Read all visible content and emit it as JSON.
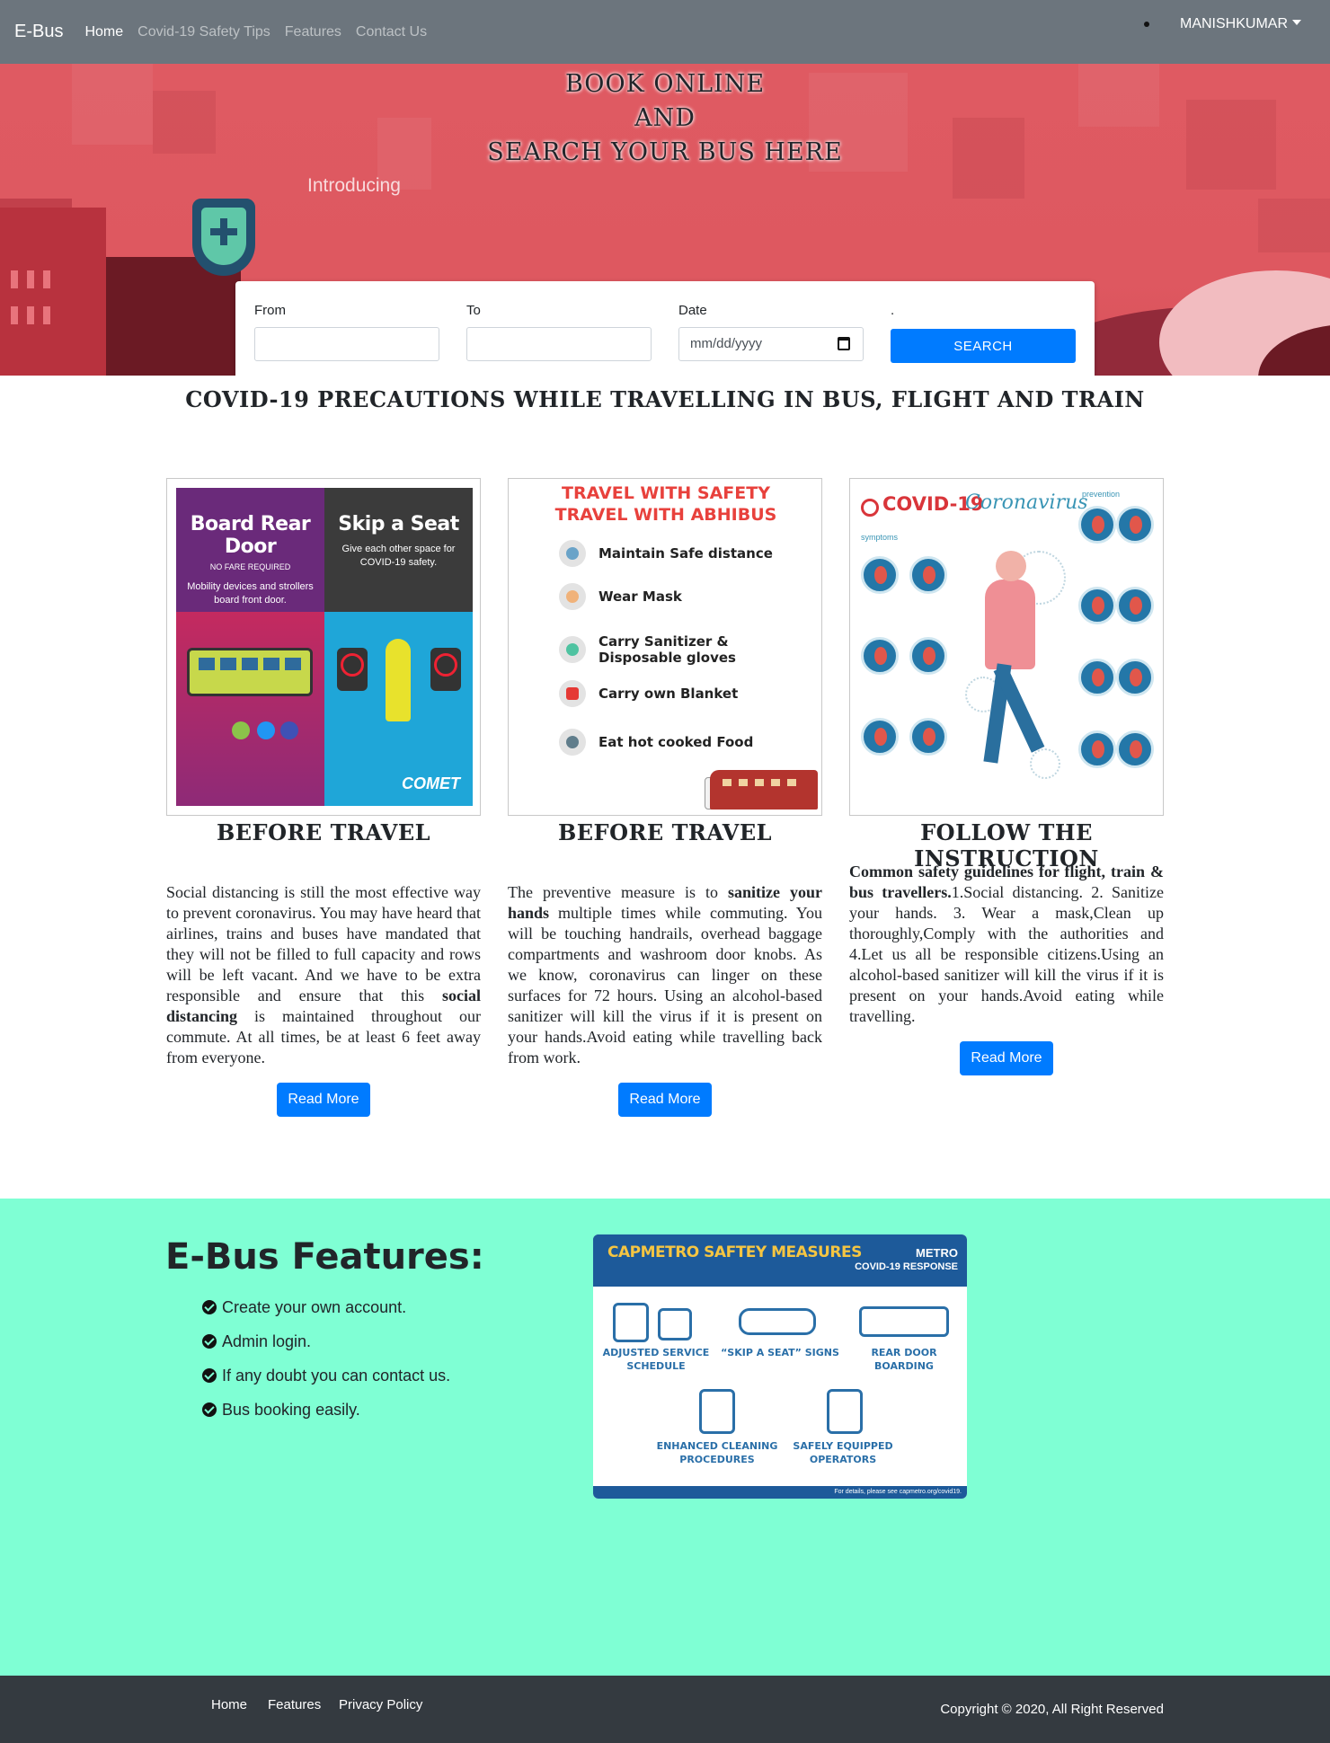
{
  "navbar": {
    "brand": "E-Bus",
    "links": [
      "Home",
      "Covid-19 Safety Tips",
      "Features",
      "Contact Us"
    ],
    "user": "MANISHKUMAR"
  },
  "hero": {
    "title_line1": "BOOK ONLINE",
    "title_line2": "AND",
    "title_line3": "SEARCH YOUR BUS HERE",
    "background_text": "Introducing",
    "search": {
      "from_label": "From",
      "to_label": "To",
      "date_label": "Date",
      "date_placeholder": "mm/dd/yyyy",
      "button_label": ".",
      "button_text": "SEARCH"
    }
  },
  "precautions": {
    "title": "COVID-19 PRECAUTIONS WHILE TRAVELLING IN BUS, FLIGHT AND TRAIN",
    "cards": [
      {
        "title": "BEFORE TRAVEL",
        "poster": {
          "left_heading": "Board Rear Door",
          "left_sub": "NO FARE REQUIRED",
          "left_text": "Mobility devices and strollers board front door.",
          "right_heading": "Skip a Seat",
          "right_text": "Give each other space for COVID-19 safety.",
          "logo": "COMET"
        },
        "text_before": "Social distancing is still the most effective way to prevent coronavirus. You may have heard that airlines, trains and buses have mandated that they will not be filled to full capacity and rows will be left vacant. And we have to be extra responsible and ensure that this ",
        "text_bold": "social distancing",
        "text_after": " is maintained throughout our commute. At all times, be at least 6 feet away from everyone.",
        "button": "Read More"
      },
      {
        "title": "BEFORE TRAVEL",
        "poster": {
          "heading_line1": "TRAVEL WITH SAFETY",
          "heading_line2": "TRAVEL WITH ABHIBUS",
          "items": [
            "Maintain Safe distance",
            "Wear Mask",
            "Carry Sanitizer &",
            "Disposable gloves",
            "Carry own Blanket",
            "Eat hot cooked Food"
          ]
        },
        "text_before": "The preventive measure is to ",
        "text_bold": "sanitize your hands",
        "text_after": " multiple times while commuting. You will be touching handrails, overhead baggage compartments and washroom door knobs. As we know, coronavirus can linger on these surfaces for 72 hours. Using an alcohol-based sanitizer will kill the virus if it is present on your hands.Avoid eating while travelling back from work.",
        "button": "Read More"
      },
      {
        "title": "FOLLOW THE INSTRUCTION",
        "poster": {
          "title": "COVID-19",
          "script": "Coronavirus",
          "symptoms": "symptoms",
          "prevention": "prevention"
        },
        "text_bold": "Common safety guidelines for flight, train & bus travellers.",
        "text_after": "1.Social distancing. 2. Sanitize your hands. 3. Wear a mask,Clean up thoroughly,Comply with the authorities and 4.Let us all be responsible citizens.Using an alcohol-based sanitizer will kill the virus if it is present on your hands.Avoid eating while travelling.",
        "button": "Read More"
      }
    ]
  },
  "features": {
    "title": "E-Bus Features:",
    "items": [
      "Create your own account.",
      "Admin login.",
      "If any doubt you can contact us.",
      "Bus booking easily."
    ],
    "poster": {
      "title": "CAPMETRO SAFTEY MEASURES",
      "brand": "METRO",
      "subtitle": "COVID-19 RESPONSE",
      "labels": [
        "ADJUSTED SERVICE SCHEDULE",
        "“SKIP A SEAT” SIGNS",
        "REAR DOOR BOARDING",
        "ENHANCED CLEANING PROCEDURES",
        "SAFELY EQUIPPED OPERATORS"
      ],
      "footer": "For details, please see capmetro.org/covid19."
    }
  },
  "footer": {
    "links": [
      "Home",
      "Features",
      "Privacy Policy"
    ],
    "copyright": "Copyright © 2020, All Right Reserved"
  },
  "colors": {
    "navbar": "#6c757d",
    "primary": "#007bff",
    "hero": "#df5a62",
    "features_bg": "#7fffd4",
    "footer": "#343a40"
  }
}
